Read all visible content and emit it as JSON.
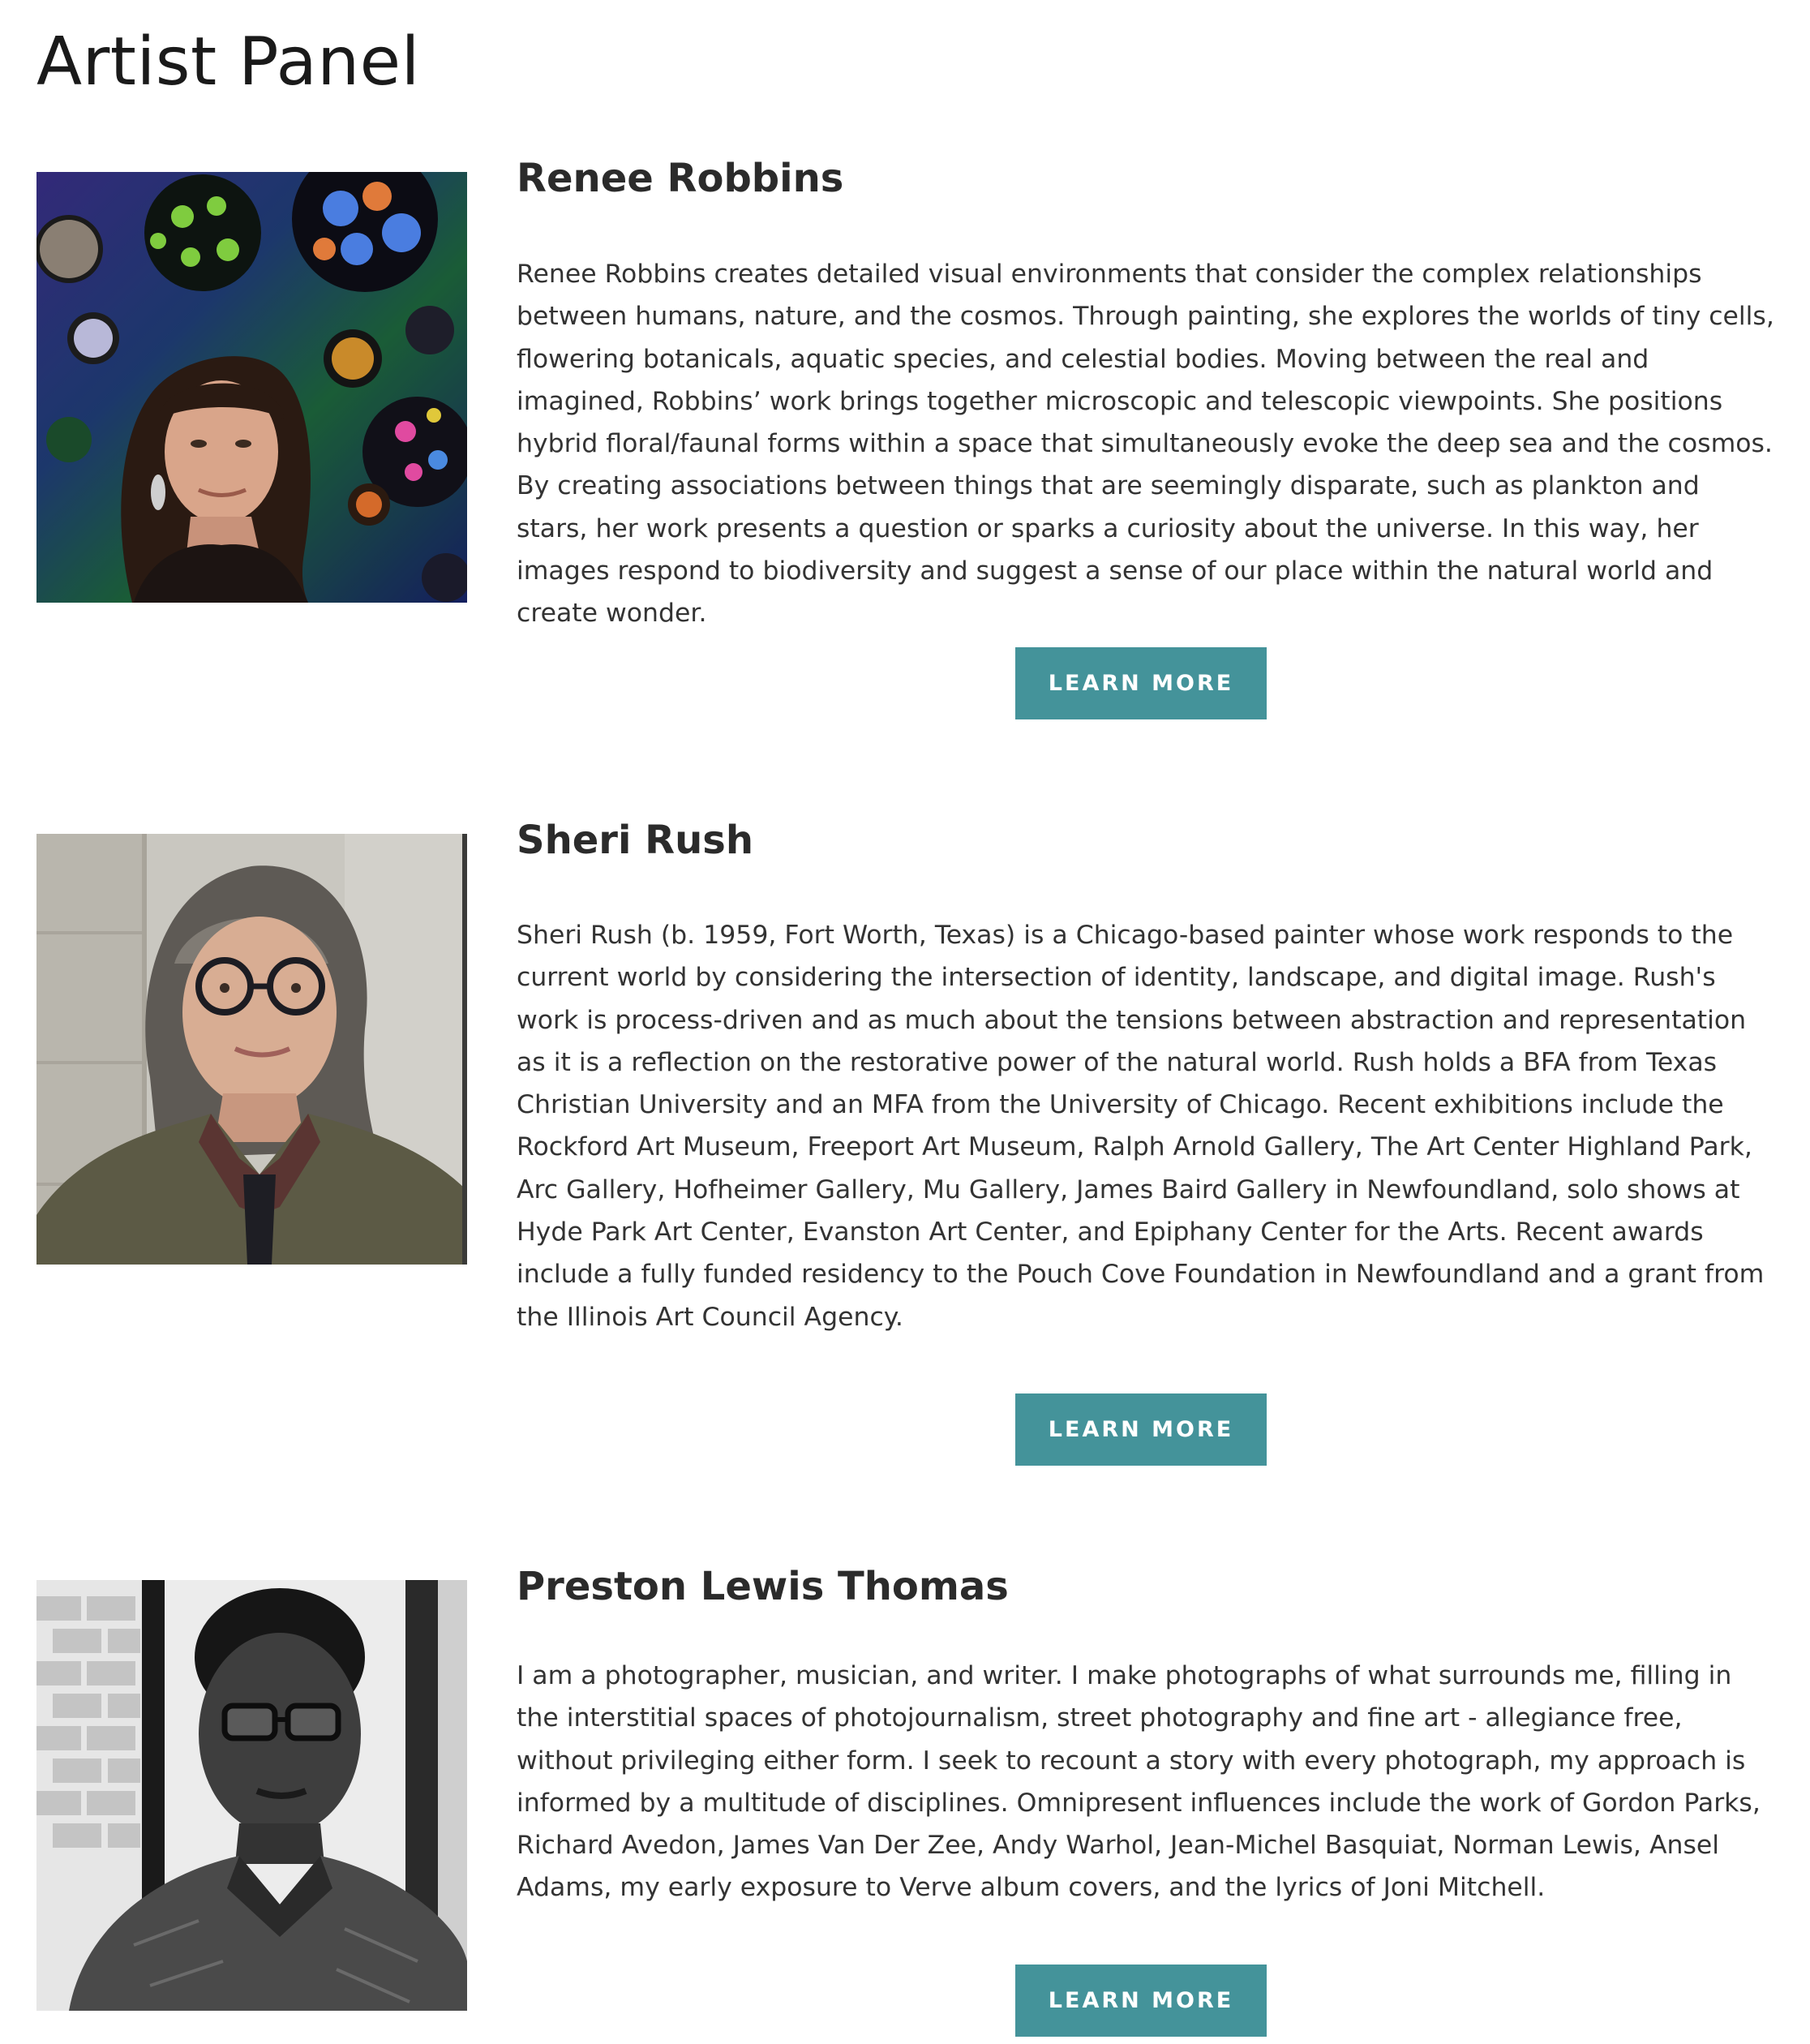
{
  "page": {
    "title": "Artist Panel"
  },
  "button_color": "#44939a",
  "artists": [
    {
      "name": "Renee Robbins",
      "bio": "Renee Robbins creates detailed visual environments that consider the complex relationships between humans, nature, and the cosmos. Through painting, she explores the worlds of tiny cells, flowering botanicals, aquatic species, and celestial bodies. Moving between the real and imagined, Robbins’ work brings together microscopic and telescopic viewpoints. She positions hybrid floral/faunal forms within a space that simultaneously evoke the deep sea and the cosmos. By creating associations between things that are seemingly disparate, such as plankton and stars, her work presents a question or sparks a curiosity about the universe. In this way, her images respond to biodiversity and suggest a sense of our place within the natural world and create wonder.",
      "button_label": "LEARN MORE"
    },
    {
      "name": "Sheri Rush",
      "bio": "Sheri Rush (b. 1959, Fort Worth, Texas) is a Chicago-based painter whose work responds to the current world by considering the intersection of identity, landscape, and digital image. Rush's work is process-driven and as much about the tensions between abstraction and representation as it is a reflection on the restorative power of the natural world. Rush holds a BFA from Texas Christian University and an MFA from the University of Chicago. Recent exhibitions include the Rockford Art Museum, Freeport Art Museum, Ralph Arnold Gallery, The Art Center Highland Park, Arc Gallery, Hofheimer Gallery, Mu Gallery, James Baird Gallery in Newfoundland, solo shows at Hyde Park Art Center, Evanston Art Center, and Epiphany Center for the Arts. Recent awards include a fully funded residency to the Pouch Cove Foundation in Newfoundland and a grant from the Illinois Art Council Agency.",
      "button_label": "LEARN MORE"
    },
    {
      "name": "Preston Lewis Thomas",
      "bio": "I am a photographer, musician, and writer. I make photographs of what surrounds me, filling in the interstitial spaces of photojournalism, street photography and fine art - allegiance free, without privileging either form. I seek to recount a story with every photograph, my approach is informed by a multitude of disciplines. Omnipresent influences include the work of Gordon Parks, Richard Avedon, James Van Der Zee, Andy Warhol, Jean-Michel Basquiat, Norman Lewis, Ansel Adams, my early exposure to Verve album covers, and the lyrics of Joni Mitchell.",
      "button_label": "LEARN MORE"
    }
  ]
}
